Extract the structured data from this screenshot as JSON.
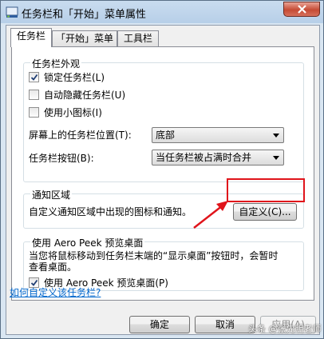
{
  "window": {
    "title": "任务栏和「开始」菜单属性"
  },
  "tabs": [
    {
      "label": "任务栏"
    },
    {
      "label": "「开始」菜单"
    },
    {
      "label": "工具栏"
    }
  ],
  "appearance": {
    "group_label": "任务栏外观",
    "lock_taskbar": {
      "label": "锁定任务栏(L)",
      "checked": true
    },
    "auto_hide": {
      "label": "自动隐藏任务栏(U)",
      "checked": false
    },
    "small_icons": {
      "label": "使用小图标(I)",
      "checked": false
    },
    "location_label": "屏幕上的任务栏位置(T):",
    "location_value": "底部",
    "buttons_label": "任务栏按钮(B):",
    "buttons_value": "当任务栏被占满时合并"
  },
  "notification": {
    "group_label": "通知区域",
    "description": "自定义通知区域中出现的图标和通知。",
    "customize_button": "自定义(C)..."
  },
  "aero_peek": {
    "group_label": "使用 Aero Peek 预览桌面",
    "description_line1": "当您将鼠标移动到任务栏末端的“显示桌面”按钮时，会暂时",
    "description_line2": "查看桌面。",
    "checkbox": {
      "label": "使用 Aero Peek 预览桌面(P)",
      "checked": true
    }
  },
  "help_link": "如何自定义该任务栏?",
  "footer": {
    "ok": "确定",
    "cancel": "取消",
    "apply": "应用(A)"
  },
  "annotation_color": "#e0141b",
  "watermark": "头条 @张先明老师"
}
